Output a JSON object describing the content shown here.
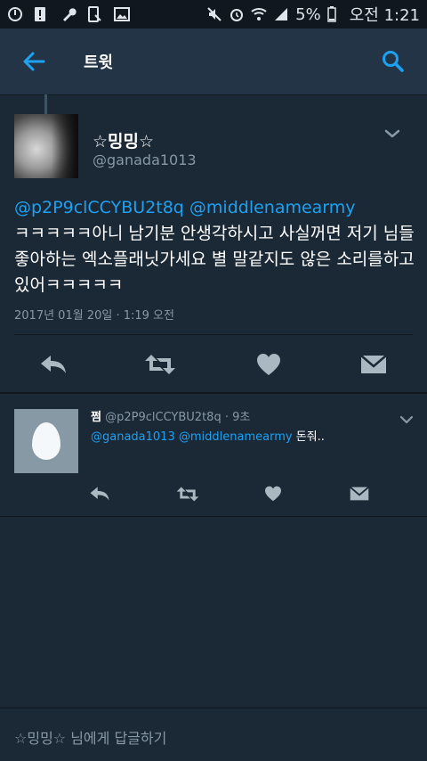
{
  "status_bar": {
    "battery_percent": "5%",
    "time": "오전 1:21"
  },
  "app_bar": {
    "title": "트윗"
  },
  "tweet": {
    "display_name": "☆밍밍☆",
    "username": "@ganada1013",
    "mentions": [
      "@p2P9clCCYBU2t8q",
      "@middlenamearmy"
    ],
    "text": "ㅋㅋㅋㅋㅋ아니 남기분 안생각하시고 사실꺼면 저기 님들좋아하는 엑소플래닛가세요 별 말같지도 않은 소리를하고있어ㅋㅋㅋㅋㅋ",
    "timestamp": "2017년 01월 20일 · 1:19 오전"
  },
  "reply_tweet": {
    "display_name": "쩜",
    "username": "@p2P9clCCYBU2t8q",
    "time": "· 9초",
    "mentions": [
      "@ganada1013",
      "@middlenamearmy"
    ],
    "text": "돈줘.."
  },
  "reply_bar": {
    "placeholder": "☆밍밍☆ 님에게 답글하기"
  },
  "colors": {
    "background": "#1b2836",
    "app_bar": "#243447",
    "accent": "#1da1f2",
    "secondary_text": "#8899a6",
    "icon_gray": "#aab8c2"
  }
}
